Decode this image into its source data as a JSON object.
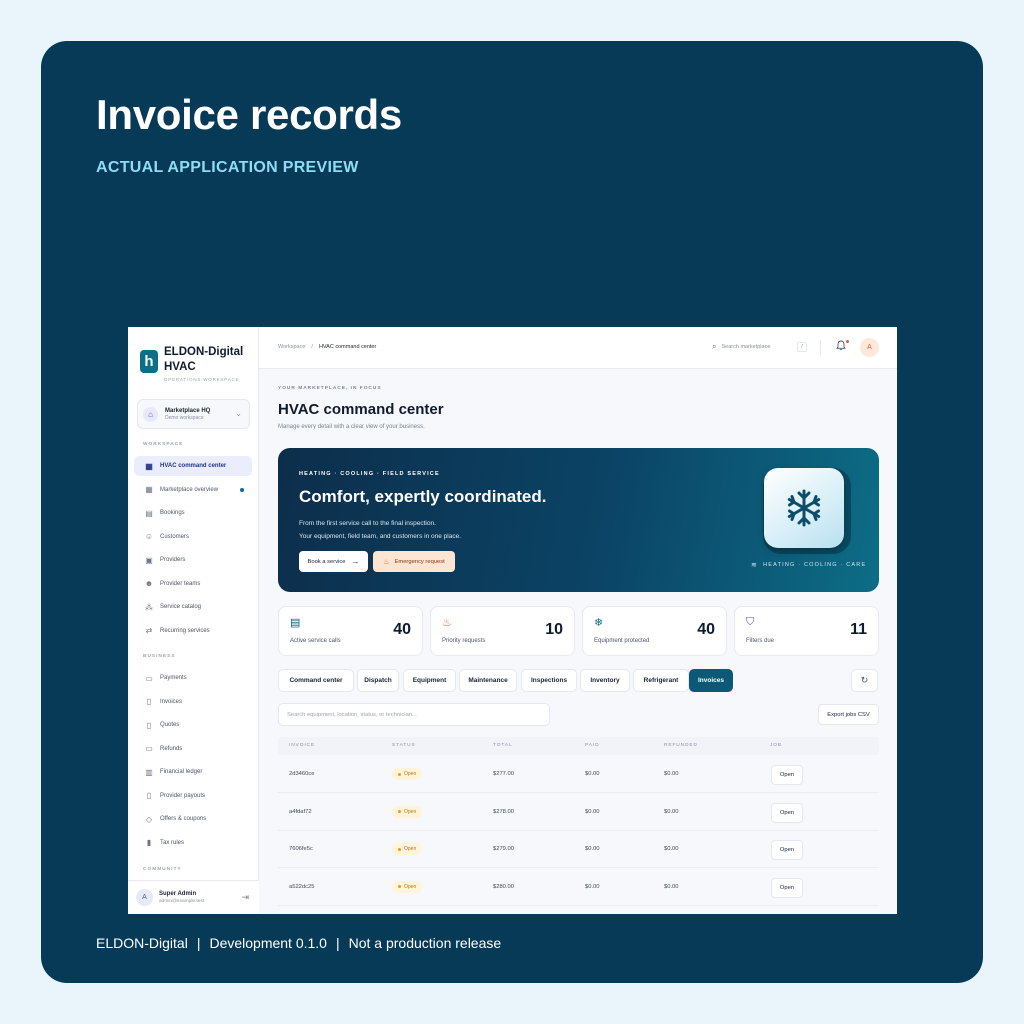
{
  "hero": {
    "title": "Invoice records",
    "subtitle": "ACTUAL APPLICATION PREVIEW",
    "footer": [
      "ELDON-Digital",
      "Development 0.1.0",
      "Not a production release"
    ]
  },
  "colors": {
    "card_bg": "#073a57",
    "accent": "#0b5877",
    "subtitle": "#8fdcf4"
  },
  "sidebar": {
    "brand_name_line1": "ELDON-Digital",
    "brand_name_line2": "HVAC",
    "brand_sub": "OPERATIONS WORKSPACE",
    "workspace_name": "Marketplace HQ",
    "workspace_sub": "Demo workspace",
    "section_workspace": "WORKSPACE",
    "section_business": "BUSINESS",
    "section_community": "COMMUNITY",
    "workspace_items": [
      {
        "label": "HVAC command center",
        "icon": "grid-icon"
      },
      {
        "label": "Marketplace overview",
        "icon": "grid-icon"
      },
      {
        "label": "Bookings",
        "icon": "calendar-icon"
      },
      {
        "label": "Customers",
        "icon": "users-icon"
      },
      {
        "label": "Providers",
        "icon": "briefcase-icon"
      },
      {
        "label": "Provider teams",
        "icon": "team-icon"
      },
      {
        "label": "Service catalog",
        "icon": "shapes-icon"
      },
      {
        "label": "Recurring services",
        "icon": "repeat-icon"
      }
    ],
    "business_items": [
      {
        "label": "Payments",
        "icon": "card-icon"
      },
      {
        "label": "Invoices",
        "icon": "document-icon"
      },
      {
        "label": "Quotes",
        "icon": "document-icon"
      },
      {
        "label": "Refunds",
        "icon": "wallet-icon"
      },
      {
        "label": "Financial ledger",
        "icon": "chart-icon"
      },
      {
        "label": "Provider payouts",
        "icon": "document-icon"
      },
      {
        "label": "Offers & coupons",
        "icon": "tag-icon"
      },
      {
        "label": "Tax rules",
        "icon": "receipt-icon"
      }
    ],
    "user_name": "Super Admin",
    "user_email": "admin@example.test",
    "user_initial": "A"
  },
  "topbar": {
    "crumb_root": "Workspace",
    "crumb_current": "HVAC command center",
    "search_placeholder": "Search marketplace",
    "kbd": "/",
    "avatar_initial": "A"
  },
  "page": {
    "eyebrow": "YOUR MARKETPLACE, IN FOCUS",
    "title": "HVAC command center",
    "description": "Manage every detail with a clear view of your business."
  },
  "banner": {
    "kicker": "HEATING · COOLING · FIELD SERVICE",
    "title": "Comfort, expertly coordinated.",
    "line1": "From the first service call to the final inspection.",
    "line2": "Your equipment, field team, and customers in one place.",
    "book_label": "Book a service",
    "emergency_label": "Emergency request",
    "tag": "HEATING · COOLING · CARE"
  },
  "stats": [
    {
      "label": "Active service calls",
      "value": "40",
      "icon": "calendar-icon",
      "color": "#0b5877"
    },
    {
      "label": "Priority requests",
      "value": "10",
      "icon": "flame-icon",
      "color": "#d9622b"
    },
    {
      "label": "Equipment protected",
      "value": "40",
      "icon": "snowflake-icon",
      "color": "#0b6f8a"
    },
    {
      "label": "Filters due",
      "value": "11",
      "icon": "shield-icon",
      "color": "#4e5bb0"
    }
  ],
  "tabs": [
    "Command center",
    "Dispatch",
    "Equipment",
    "Maintenance",
    "Inspections",
    "Inventory",
    "Refrigerant",
    "Invoices"
  ],
  "active_tab": "Invoices",
  "table": {
    "search_placeholder": "Search equipment, location, status, or technician...",
    "export_label": "Export jobs CSV",
    "columns": [
      "INVOICE",
      "STATUS",
      "TOTAL",
      "PAID",
      "REFUNDED",
      "JOB"
    ],
    "rows": [
      {
        "invoice": "2d3460ce",
        "status": "Open",
        "total": "$277.00",
        "paid": "$0.00",
        "refunded": "$0.00",
        "job": "Open"
      },
      {
        "invoice": "a4fdaf72",
        "status": "Open",
        "total": "$278.00",
        "paid": "$0.00",
        "refunded": "$0.00",
        "job": "Open"
      },
      {
        "invoice": "7606fe5c",
        "status": "Open",
        "total": "$279.00",
        "paid": "$0.00",
        "refunded": "$0.00",
        "job": "Open"
      },
      {
        "invoice": "a522dc25",
        "status": "Open",
        "total": "$280.00",
        "paid": "$0.00",
        "refunded": "$0.00",
        "job": "Open"
      }
    ]
  }
}
